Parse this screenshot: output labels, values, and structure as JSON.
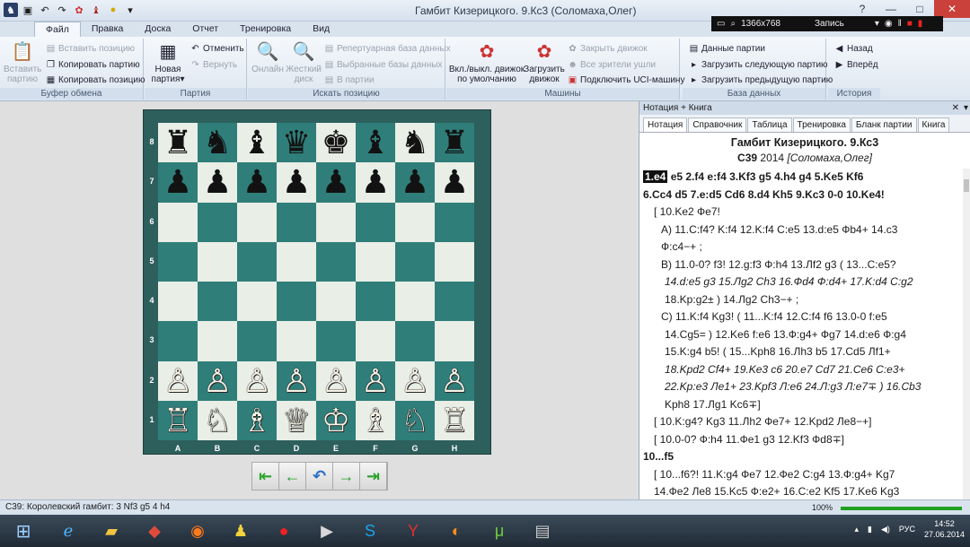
{
  "window": {
    "title": "Гамбит Кизерицкого. 9.Кс3  (Соломаха,Олег)"
  },
  "recorder": {
    "resolution": "1366x768",
    "label": "Запись"
  },
  "tabs": [
    "Файл",
    "Правка",
    "Доска",
    "Отчет",
    "Тренировка",
    "Вид"
  ],
  "ribbon": {
    "clip_insert": "Вставить позицию",
    "clip_copy_game": "Копировать партию",
    "clip_copy_pos": "Копировать позицию",
    "clip_paste": "Вставить партию",
    "clip_group": "Буфер обмена",
    "game_new": "Новая партия",
    "game_undo": "Отменить",
    "game_redo": "Вернуть",
    "game_group": "Партия",
    "search_online": "Онлайн",
    "search_disk": "Жесткий диск",
    "search_rep": "Репертуарная база данных",
    "search_sel": "Выбранные базы данных",
    "search_game": "В партии",
    "search_group": "Искать позицию",
    "eng_toggle": "Вкл./выкл. движок по умолчанию",
    "eng_load": "Загрузить движок",
    "eng_close": "Закрыть движок",
    "eng_viewers": "Все зрители ушли",
    "eng_uci": "Подключить UCI-машину",
    "eng_group": "Машины",
    "db_data": "Данные партии",
    "db_next": "Загрузить следующую партию",
    "db_prev": "Загрузить предыдущую партию",
    "db_group": "База данных",
    "hist_back": "Назад",
    "hist_fwd": "Вперёд",
    "hist_group": "История"
  },
  "board": {
    "ranks": [
      "8",
      "7",
      "6",
      "5",
      "4",
      "3",
      "2",
      "1"
    ],
    "files": [
      "A",
      "B",
      "C",
      "D",
      "E",
      "F",
      "G",
      "H"
    ],
    "rows": [
      [
        "♜",
        "♞",
        "♝",
        "♛",
        "♚",
        "♝",
        "♞",
        "♜"
      ],
      [
        "♟",
        "♟",
        "♟",
        "♟",
        "♟",
        "♟",
        "♟",
        "♟"
      ],
      [
        "",
        "",
        "",
        "",
        "",
        "",
        "",
        ""
      ],
      [
        "",
        "",
        "",
        "",
        "",
        "",
        "",
        ""
      ],
      [
        "",
        "",
        "",
        "",
        "",
        "",
        "",
        ""
      ],
      [
        "",
        "",
        "",
        "",
        "",
        "",
        "",
        ""
      ],
      [
        "♙",
        "♙",
        "♙",
        "♙",
        "♙",
        "♙",
        "♙",
        "♙"
      ],
      [
        "♖",
        "♘",
        "♗",
        "♕",
        "♔",
        "♗",
        "♘",
        "♖"
      ]
    ]
  },
  "panel": {
    "title": "Нотация + Книга",
    "tabs": [
      "Нотация",
      "Справочник",
      "Таблица",
      "Тренировка",
      "Бланк партии",
      "Книга"
    ],
    "game_title": "Гамбит Кизерицкого. 9.Кс3",
    "eco": "C39",
    "year": "2014",
    "players": "[Соломаха,Олег]"
  },
  "notation": {
    "first_move": "1.e4",
    "lines": [
      "e5  2.f4  e:f4  3.Kf3  g5  4.h4  g4  5.Ke5  Kf6",
      "6.Cc4  d5  7.e:d5  Cd6  8.d4  Kh5  9.Kc3  0-0  10.Ke4!",
      "[ 10.Ke2  Фe7!",
      "А)   11.С:f4?  K:f4  12.K:f4  С:e5  13.d:e5  Фb4+  14.c3",
      "Ф:c4−+ ;",
      "В)   11.0-0?  f3!  12.g:f3  Ф:h4  13.Лf2  g3   ( 13...С:e5?",
      "14.d:e5  g3  15.Лg2  Ch3  16.Фd4  Ф:d4+  17.K:d4  С:g2",
      "18.Kp:g2± )  14.Лg2  Ch3−+ ;",
      "С)   11.K:f4  Kg3!   ( 11...K:f4  12.С:f4  f6  13.0-0  f:e5",
      "14.Cg5= )  12.Ke6  f:e6  13.Ф:g4+  Фg7  14.d:e6  Ф:g4",
      "15.K:g4  b5!   ( 15...Kph8  16.Лh3  b5  17.Cd5  Лf1+",
      "18.Kpd2  Cf4+  19.Ke3  c6  20.e7  Cd7  21.Ce6  C:e3+",
      "22.Kp:e3  Лe1+  23.Kpf3  Л:e6  24.Л:g3  Л:e7∓ )   16.Cb3",
      "Kph8  17.Лg1  Kc6∓]",
      "[ 10.K:g4?  Kg3  11.Лh2  Фe7+  12.Kpd2  Лe8−+]",
      "[ 10.0-0?  Ф:h4  11.Фe1  g3  12.Kf3  Фd8∓]",
      "10...f5",
      "[ 10...f6?!  11.K:g4  Фe7  12.Фe2  С:g4  13.Ф:g4+  Kg7",
      "14.Фe2  Лe8  15.Kc5  Ф:e2+  16.С:e2  Kf5  17.Ke6  Kg3"
    ]
  },
  "status": {
    "text": "C39: Королевский гамбит: 3 Nf3 g5 4 h4",
    "zoom": "100%"
  },
  "tray": {
    "lang": "РУС",
    "time": "14:52",
    "date": "27.06.2014"
  }
}
